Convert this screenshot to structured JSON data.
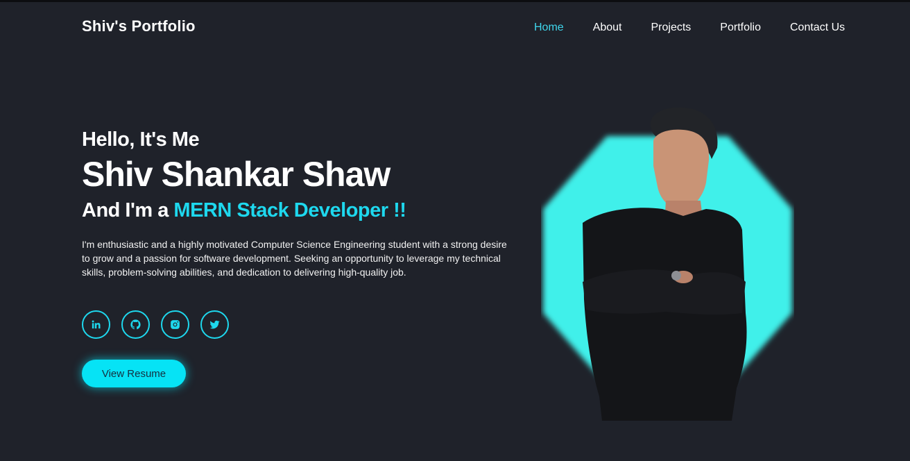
{
  "brand": {
    "title": "Shiv's Portfolio"
  },
  "nav": {
    "items": [
      {
        "label": "Home",
        "active": true
      },
      {
        "label": "About",
        "active": false
      },
      {
        "label": "Projects",
        "active": false
      },
      {
        "label": "Portfolio",
        "active": false
      },
      {
        "label": "Contact Us",
        "active": false
      }
    ]
  },
  "hero": {
    "greeting": "Hello, It's Me",
    "name": "Shiv Shankar Shaw",
    "role_prefix": "And I'm a ",
    "role_highlight": "MERN Stack Developer !!",
    "bio": "I'm enthusiastic and a highly motivated Computer Science Engineering student with a strong desire to grow and a passion for software development. Seeking an opportunity to leverage my technical skills, problem-solving abilities, and dedication to delivering high-quality job.",
    "resume_button": "View Resume"
  },
  "socials": [
    "linkedin-icon",
    "github-icon",
    "instagram-icon",
    "twitter-icon"
  ],
  "colors": {
    "background": "#1f222a",
    "accent": "#1ed8ee",
    "button": "#06e3f5",
    "nav_active": "#3fd6ec"
  }
}
